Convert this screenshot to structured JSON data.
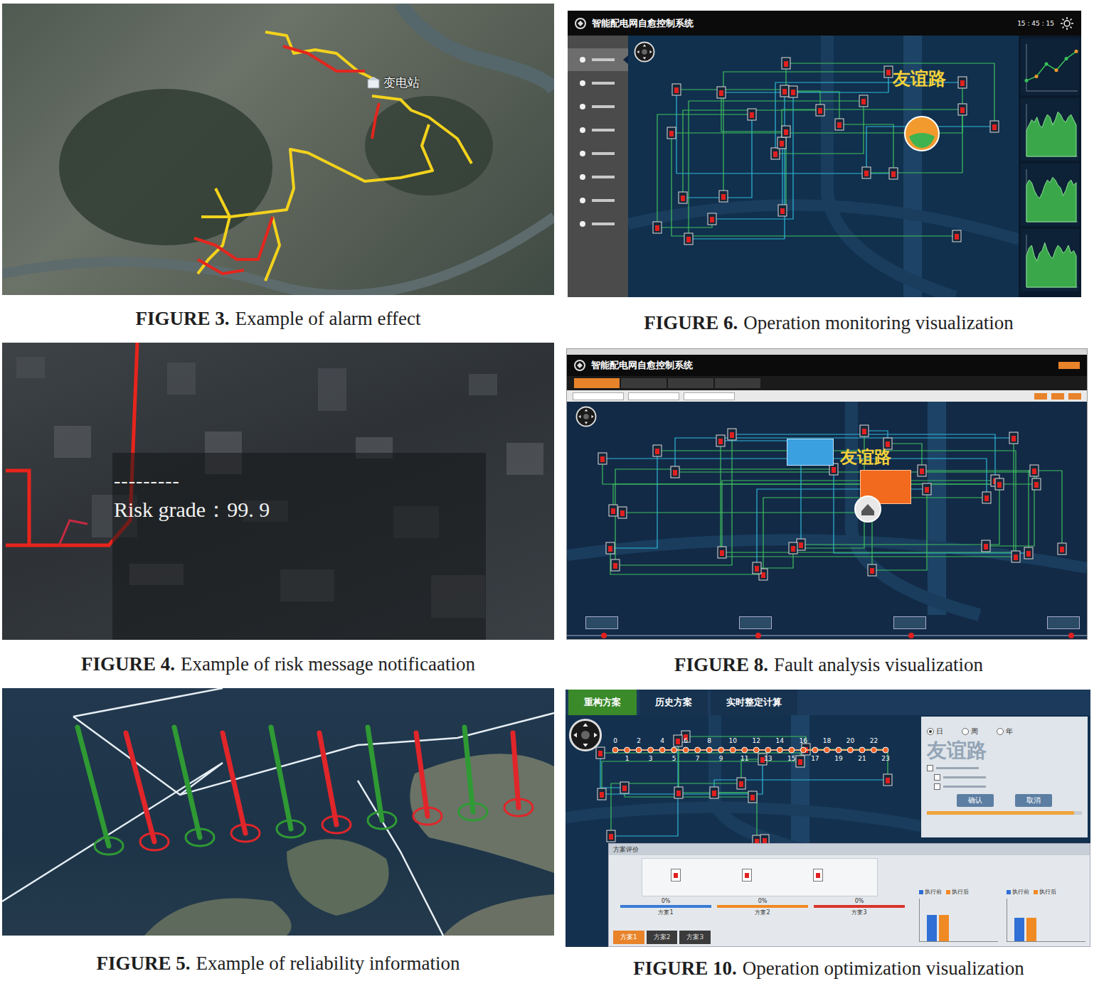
{
  "fig3": {
    "caption": {
      "num": "FIGURE 3.",
      "text": "Example of alarm effect"
    },
    "label": "变电站",
    "lines": [
      {
        "color": "#f3d21c"
      },
      {
        "color": "#f3d21c"
      },
      {
        "color": "#f3d21c"
      },
      {
        "color": "#f3d21c"
      },
      {
        "color": "#f3d21c"
      },
      {
        "color": "#e3261e"
      },
      {
        "color": "#e3261e"
      },
      {
        "color": "#e3261e"
      },
      {
        "color": "#e3261e"
      }
    ]
  },
  "fig4": {
    "caption": {
      "num": "FIGURE 4.",
      "text": "Example of risk message notificaation"
    },
    "dash": "---------",
    "risk": "Risk grade：99. 9"
  },
  "fig5": {
    "caption": {
      "num": "FIGURE 5.",
      "text": "Example of reliability information"
    },
    "pins": [
      {
        "color": "#2f9a34"
      },
      {
        "color": "#e0262a"
      },
      {
        "color": "#2f9a34"
      },
      {
        "color": "#e0262a"
      },
      {
        "color": "#2f9a34"
      },
      {
        "color": "#e0262a"
      },
      {
        "color": "#2f9a34"
      },
      {
        "color": "#e0262a"
      },
      {
        "color": "#2f9a34"
      },
      {
        "color": "#e0262a"
      }
    ]
  },
  "fig6": {
    "caption": {
      "num": "FIGURE 6.",
      "text": "Operation monitoring visualization"
    },
    "title": "智能配电网自愈控制系统",
    "clock": "15 : 45 : 15",
    "road": "友谊路",
    "sidebar": [
      {
        "selected": true
      },
      {
        "selected": false
      },
      {
        "selected": false
      },
      {
        "selected": false
      },
      {
        "selected": false
      },
      {
        "selected": false
      },
      {
        "selected": false
      },
      {
        "selected": false
      }
    ],
    "charts": [
      {
        "kind": "line",
        "values": [
          1.0,
          1.4,
          2.6,
          2.0,
          3.1,
          3.8
        ]
      },
      {
        "kind": "area",
        "values": [
          5,
          6,
          7,
          6.5,
          7.5,
          6,
          5.5,
          7,
          8,
          7.5,
          6,
          7,
          8.5,
          8,
          7,
          6.5,
          7.5,
          8,
          7,
          6
        ]
      },
      {
        "kind": "area",
        "values": [
          7,
          8,
          7.5,
          6,
          5,
          4.5,
          5.5,
          7,
          8,
          7.5,
          8.5,
          8,
          7,
          6.5,
          5,
          6,
          7.5,
          8,
          7,
          7.5
        ]
      },
      {
        "kind": "area",
        "values": [
          6,
          7.5,
          8,
          6,
          5,
          6.5,
          7,
          8.5,
          7,
          6,
          5.5,
          7,
          8,
          7.5,
          6.5,
          7,
          8,
          6.5,
          7,
          6
        ]
      }
    ]
  },
  "fig8": {
    "caption": {
      "num": "FIGURE 8.",
      "text": "Fault analysis visualization"
    },
    "title": "智能配电网自愈控制系统",
    "road": "友谊路",
    "tabs": [
      {
        "selected": true
      },
      {
        "selected": false
      },
      {
        "selected": false
      },
      {
        "selected": false
      }
    ]
  },
  "fig10": {
    "caption": {
      "num": "FIGURE 10.",
      "text": "Operation optimization visualization"
    },
    "tabs": [
      {
        "label": "重构方案",
        "selected": true
      },
      {
        "label": "历史方案",
        "selected": false
      },
      {
        "label": "实时整定计算",
        "selected": false
      }
    ],
    "timeline": [
      "0",
      "1",
      "2",
      "3",
      "4",
      "5",
      "6",
      "7",
      "8",
      "9",
      "10",
      "11",
      "12",
      "13",
      "14",
      "15",
      "16",
      "17",
      "18",
      "19",
      "20",
      "21",
      "22",
      "23"
    ],
    "road": "友谊路",
    "radios": [
      {
        "label": "日",
        "selected": true
      },
      {
        "label": "周",
        "selected": false
      },
      {
        "label": "年",
        "selected": false
      }
    ],
    "buttons": [
      "确认",
      "取消"
    ],
    "progress": {
      "level": 0.95
    },
    "panel_title": "方案评价",
    "schemes": [
      {
        "label": "方案1",
        "percent": "0%",
        "color": "#3a7bd5"
      },
      {
        "label": "方案2",
        "percent": "0%",
        "color": "#f08a24"
      },
      {
        "label": "方案3",
        "percent": "0%",
        "color": "#d9342b"
      }
    ],
    "scheme_tabs": [
      {
        "label": "方案1",
        "selected": true
      },
      {
        "label": "方案2",
        "selected": false
      },
      {
        "label": "方案3",
        "selected": false
      }
    ],
    "results": [
      {
        "legend": [
          {
            "label": "执行前",
            "color": "#2f6fd6"
          },
          {
            "label": "执行后",
            "color": "#f08a24"
          }
        ],
        "values": [
          0.62,
          0.62
        ]
      },
      {
        "legend": [
          {
            "label": "执行前",
            "color": "#2f6fd6"
          },
          {
            "label": "执行后",
            "color": "#f08a24"
          }
        ],
        "values": [
          0.55,
          0.55
        ]
      }
    ]
  }
}
